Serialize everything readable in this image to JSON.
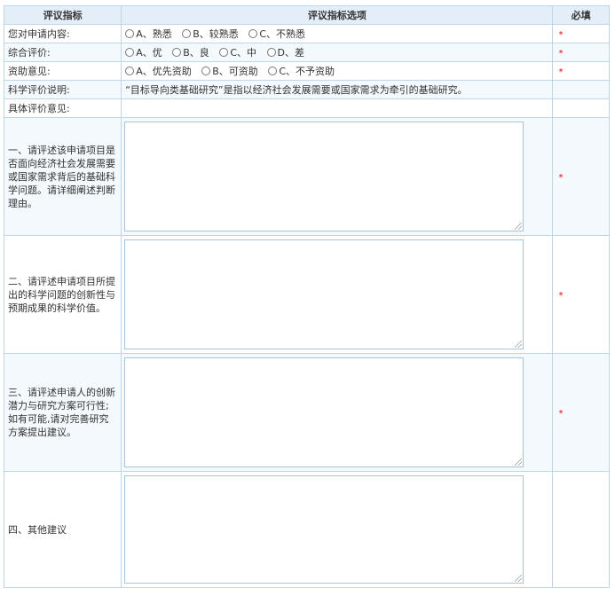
{
  "header": {
    "col_indicator": "评议指标",
    "col_options": "评议指标选项",
    "col_required": "必填"
  },
  "rows": {
    "familiarity": {
      "label": "您对申请内容:",
      "options": [
        "A、熟悉",
        "B、较熟悉",
        "C、不熟悉"
      ],
      "required": "*"
    },
    "overall": {
      "label": "综合评价:",
      "options": [
        "A、优",
        "B、良",
        "C、中",
        "D、差"
      ],
      "required": "*"
    },
    "funding": {
      "label": "资助意见:",
      "options": [
        "A、优先资助",
        "B、可资助",
        "C、不予资助"
      ],
      "required": "*"
    },
    "sci_note": {
      "label": "科学评价说明:",
      "text": "“目标导向类基础研究”是指以经济社会发展需要或国家需求为牵引的基础研究。"
    },
    "specific": {
      "label": "具体评价意见:"
    }
  },
  "questions": [
    {
      "label": "一、请评述该申请项目是否面向经济社会发展需要或国家需求背后的基础科学问题。请详细阐述判断理由。",
      "value": "",
      "required": "*"
    },
    {
      "label": "二、请评述申请项目所提出的科学问题的创新性与预期成果的科学价值。",
      "value": "",
      "required": "*"
    },
    {
      "label": "三、请评述申请人的创新潜力与研究方案可行性;如有可能,请对完善研究方案提出建议。",
      "value": "",
      "required": "*"
    },
    {
      "label": "四、其他建议",
      "value": "",
      "required": ""
    }
  ]
}
